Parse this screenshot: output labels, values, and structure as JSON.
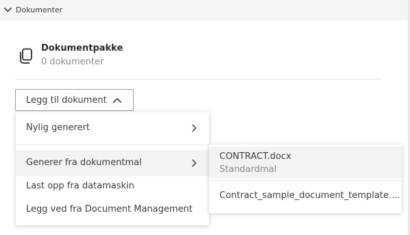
{
  "section": {
    "title": "Dokumenter",
    "expanded": true
  },
  "package": {
    "title": "Dokumentpakke",
    "subtitle": "0 dokumenter",
    "icon": "copy-icon"
  },
  "add_button": {
    "label": "Legg til dokument",
    "state": "open"
  },
  "menu": {
    "items": [
      {
        "label": "Nylig generert",
        "has_submenu": true
      },
      {
        "label": "Generer fra dokumentmal",
        "has_submenu": true,
        "highlighted": true
      },
      {
        "label": "Last opp fra datamaskin",
        "has_submenu": false
      },
      {
        "label": "Legg ved fra Document Management",
        "has_submenu": false
      }
    ]
  },
  "submenu": {
    "items": [
      {
        "title": "CONTRACT.docx",
        "description": "Standardmal",
        "highlighted": true
      },
      {
        "title": "Contract_sample_document_template...."
      }
    ]
  },
  "colors": {
    "header_bg": "#f5f5f5",
    "highlight_bg": "#f3f3f3",
    "text": "#3c3c3c",
    "muted": "#8a8a8a"
  }
}
